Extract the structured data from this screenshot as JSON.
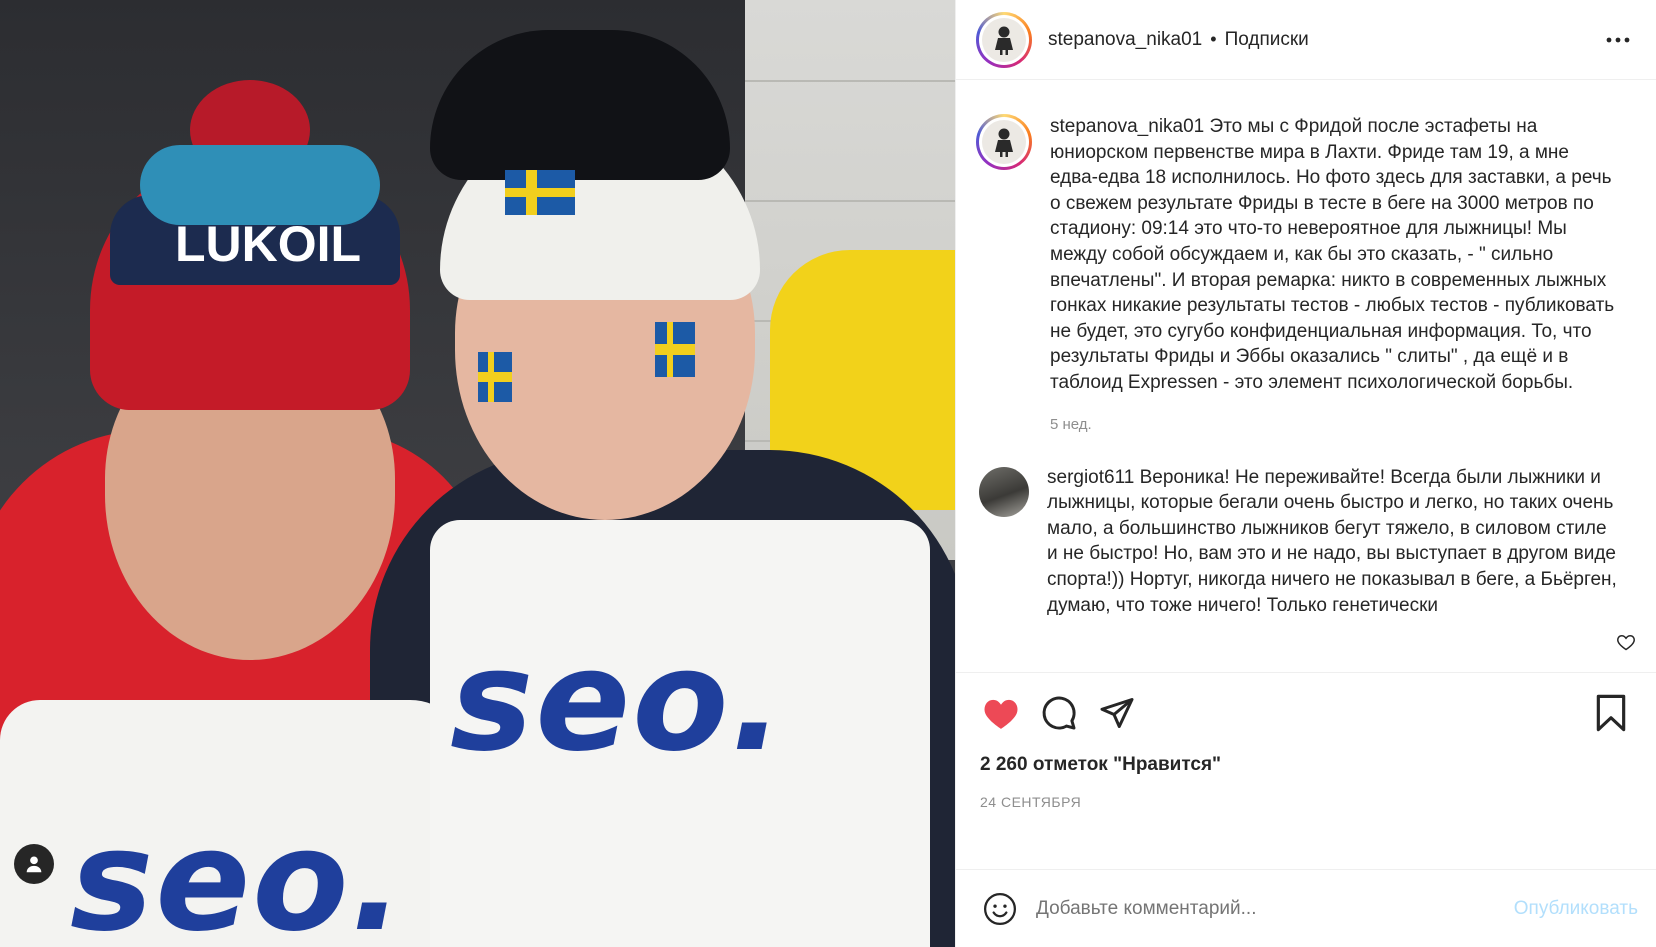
{
  "post": {
    "author": "stepanova_nika01",
    "follow_state": "Подписки",
    "caption": "Это мы с Фридой после эстафеты на юниорском первенстве мира в Лахти. Фриде там 19, а мне едва-едва 18 исполнилось.  Но фото здесь для заставки, а речь о свежем результате Фриды в тесте в беге на 3000 метров по стадиону: 09:14 это что-то невероятное для лыжницы! Мы между собой обсуждаем и, как бы это сказать, - \" сильно впечатлены\".  И вторая ремарка: никто в современных лыжных гонках никакие результаты тестов  - любых тестов - публиковать не будет, это сугубо конфиденциальная информация. То,  что результаты Фриды и Эббы оказались \" слиты\" , да ещё и в таблоид Expressen - это элемент психологической борьбы.",
    "caption_age": "5 нед.",
    "likes_text": "2 260 отметок \"Нравится\"",
    "date": "24 СЕНТЯБРЯ"
  },
  "photo": {
    "hat_text": "LUKOIL",
    "bib_text_right": "seo.",
    "bib_text_left": "seo."
  },
  "comments": [
    {
      "author": "sergiot611",
      "text": "Вероника! Не переживайте! Всегда были лыжники и лыжницы, которые бегали очень быстро и легко, но таких очень мало, а большинство лыжников бегут тяжело, в силовом стиле и не быстро! Но, вам это и не надо, вы выступает в другом виде спорта!)) Нортуг, никогда ничего не показывал в беге, а Бьёрген, думаю, что тоже ничего! Только генетически"
    }
  ],
  "composer": {
    "placeholder": "Добавьте комментарий...",
    "post_label": "Опубликовать"
  },
  "icons": {
    "like": "heart-filled-icon",
    "comment": "comment-bubble-icon",
    "share": "paper-plane-icon",
    "save": "bookmark-icon",
    "more": "more-horizontal-icon",
    "emoji": "emoji-smile-icon",
    "tagged_user": "user-tag-icon"
  },
  "colors": {
    "like_red": "#ed4956",
    "post_button_disabled": "#b2dffc",
    "secondary_text": "#8e8e8e",
    "primary_text": "#262626"
  },
  "state": {
    "liked": true
  }
}
